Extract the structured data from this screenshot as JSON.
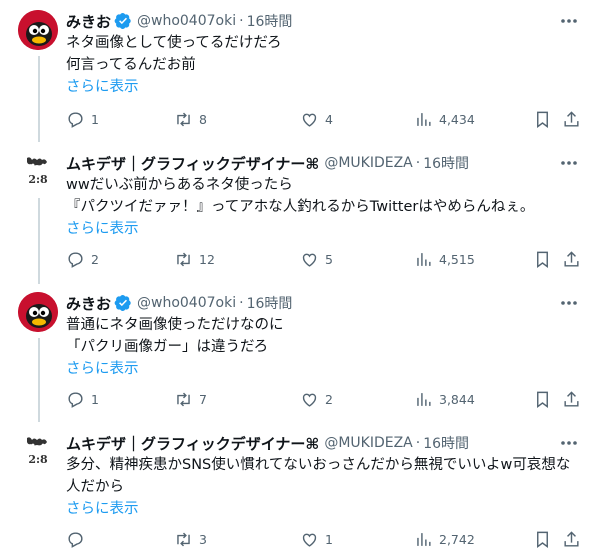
{
  "tweets": [
    {
      "name": "みきお",
      "handle": "@who0407oki",
      "time": "16時間",
      "line1": "ネタ画像として使ってるだけだろ",
      "line2": "何言ってるんだお前",
      "show_more": "さらに表示",
      "replies": "1",
      "retweets": "8",
      "likes": "4",
      "views": "4,434"
    },
    {
      "name": "ムキデザ｜グラフィックデザイナー⌘",
      "handle": "@MUKIDEZA",
      "time": "16時間",
      "line1": "wwだいぶ前からあるネタ使ったら",
      "line2": "『パクツイだァァ！』ってアホな人釣れるからTwitterはやめらんねぇ。",
      "show_more": "さらに表示",
      "replies": "2",
      "retweets": "12",
      "likes": "5",
      "views": "4,515"
    },
    {
      "name": "みきお",
      "handle": "@who0407oki",
      "time": "16時間",
      "line1": "普通にネタ画像使っただけなのに",
      "line2": "「パクリ画像ガー」は違うだろ",
      "show_more": "さらに表示",
      "replies": "1",
      "retweets": "7",
      "likes": "2",
      "views": "3,844"
    },
    {
      "name": "ムキデザ｜グラフィックデザイナー⌘",
      "handle": "@MUKIDEZA",
      "time": "16時間",
      "line1": "多分、精神疾患かSNS使い慣れてないおっさんだから無視でいいよw可哀想な",
      "line2": "人だから",
      "show_more": "さらに表示",
      "replies": "",
      "retweets": "3",
      "likes": "1",
      "views": "2,742"
    }
  ],
  "avatar_text": "2:8",
  "colors": {
    "accent": "#1d9bf0",
    "muted": "#536471",
    "text": "#0f1419",
    "divider": "#cfd9de"
  },
  "icons": [
    "reply-icon",
    "retweet-icon",
    "like-icon",
    "views-icon",
    "bookmark-icon",
    "share-icon",
    "more-icon",
    "verified-badge-icon"
  ]
}
